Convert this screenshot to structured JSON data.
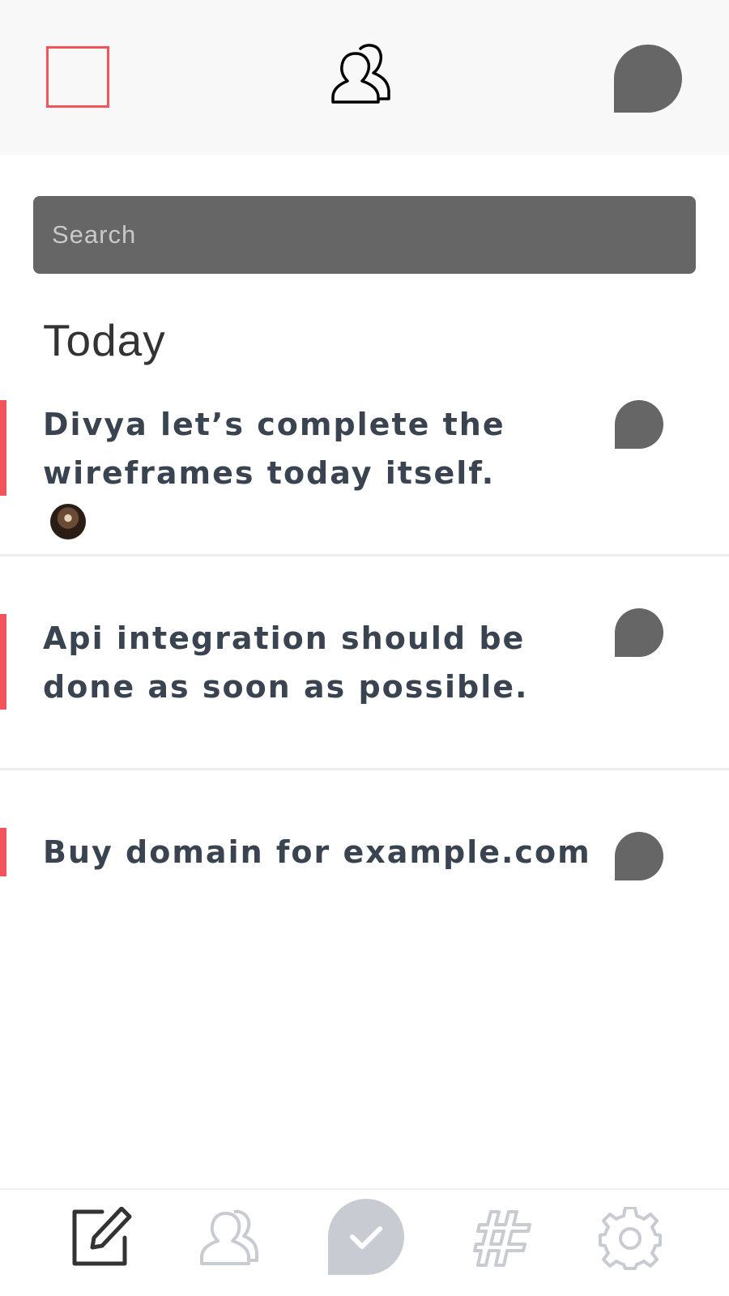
{
  "header": {
    "left_icon": "square-outline-icon",
    "center_icon": "people-icon",
    "right_icon": "chat-bubble-icon"
  },
  "search": {
    "placeholder": "Search",
    "value": ""
  },
  "section_title": "Today",
  "tasks": [
    {
      "text": "Divya let’s complete the wireframes today itself.",
      "has_avatar": true,
      "icon": "chat-bubble-icon"
    },
    {
      "text": "Api integration should be done as soon as possible.",
      "has_avatar": false,
      "icon": "chat-bubble-icon"
    },
    {
      "text": "Buy domain for example.com",
      "has_avatar": false,
      "icon": "chat-bubble-icon"
    }
  ],
  "tab_bar": {
    "items": [
      {
        "icon": "compose-icon",
        "active": true
      },
      {
        "icon": "people-icon",
        "active": false
      },
      {
        "icon": "check-icon",
        "active": false
      },
      {
        "icon": "hashtag-icon",
        "active": false
      },
      {
        "icon": "gear-icon",
        "active": false
      }
    ]
  },
  "colors": {
    "accent": "#f2545b",
    "bubble": "#666666",
    "text": "#3a4450",
    "inactive": "#c8cbd1"
  }
}
